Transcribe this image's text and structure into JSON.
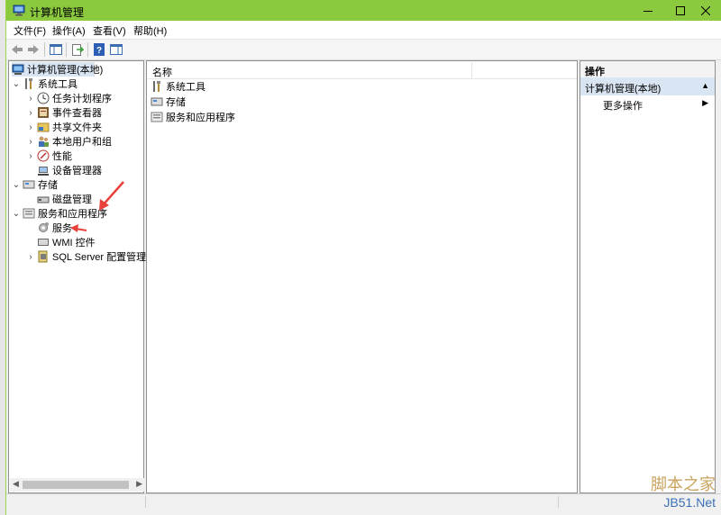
{
  "window": {
    "title": "计算机管理",
    "titlebar_color": "#8bc93e"
  },
  "menu": [
    {
      "label": "文件(F)"
    },
    {
      "label": "操作(A)"
    },
    {
      "label": "查看(V)"
    },
    {
      "label": "帮助(H)"
    }
  ],
  "tree": {
    "root": "计算机管理(本地)",
    "system_tools": "系统工具",
    "task_scheduler": "任务计划程序",
    "event_viewer": "事件查看器",
    "shared_folders": "共享文件夹",
    "local_users": "本地用户和组",
    "performance": "性能",
    "device_manager": "设备管理器",
    "storage": "存储",
    "disk_management": "磁盘管理",
    "services_apps": "服务和应用程序",
    "services": "服务",
    "wmi": "WMI 控件",
    "sql_server": "SQL Server 配置管理器"
  },
  "list": {
    "header": "名称",
    "rows": [
      "系统工具",
      "存储",
      "服务和应用程序"
    ]
  },
  "actions": {
    "title": "操作",
    "section": "计算机管理(本地)",
    "more": "更多操作",
    "highlight_color": "#d9e5f2"
  },
  "annotation_color": "#e8403a",
  "watermark": {
    "top": "脚本之家",
    "bottom": "JB51.Net"
  }
}
